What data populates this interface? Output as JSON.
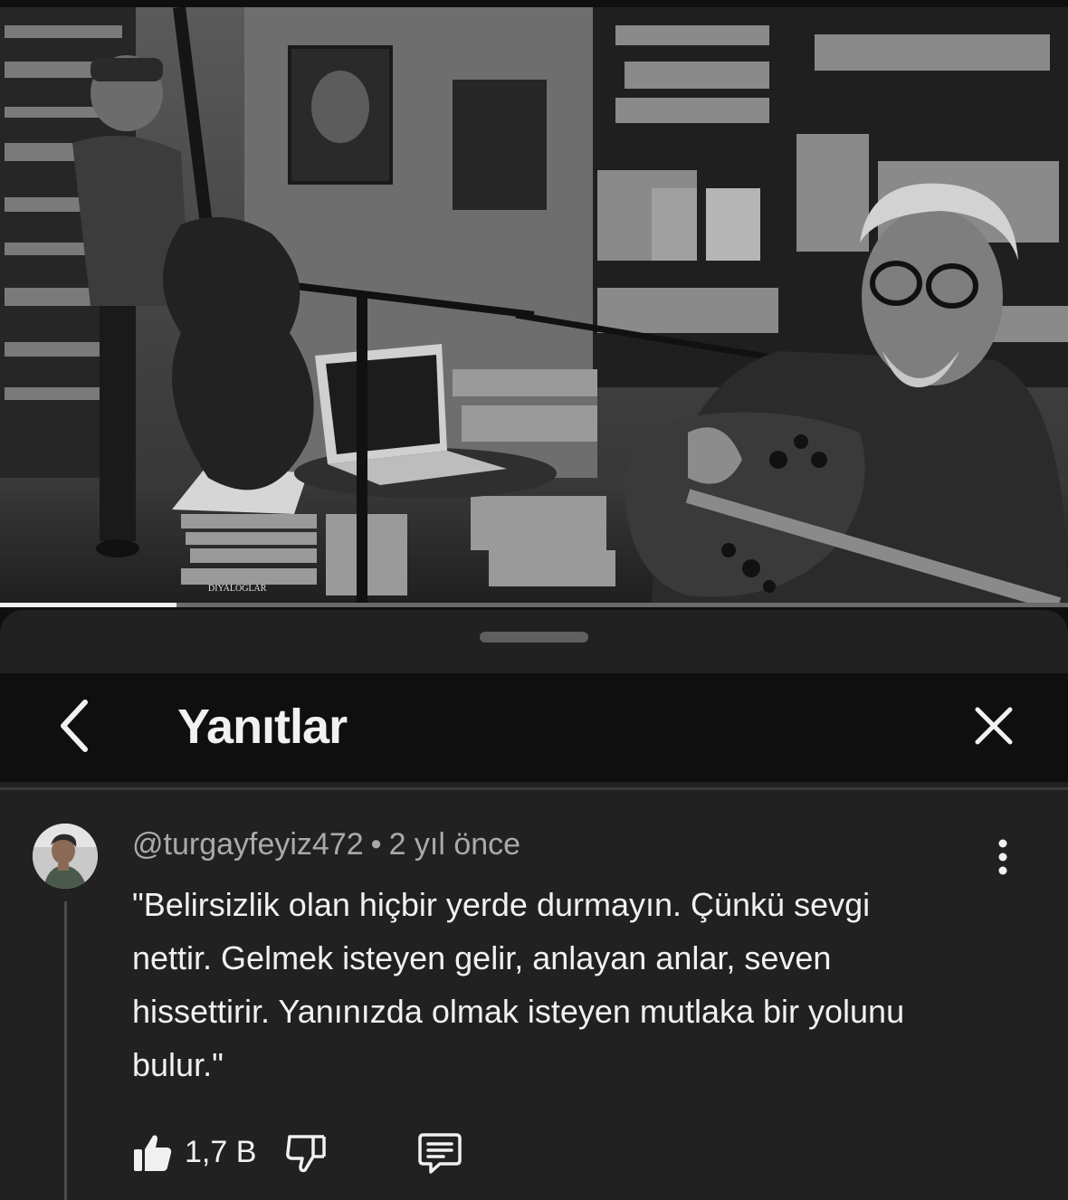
{
  "video": {
    "book_spine_text": "DIYALOGLAR",
    "progress_fraction": 0.165
  },
  "sheet": {
    "title": "Yanıtlar"
  },
  "comment": {
    "author": "@turgayfeyiz472",
    "separator": "•",
    "time": "2 yıl önce",
    "text": "\"Belirsizlik olan hiçbir yerde durmayın. Çünkü sevgi nettir. Gelmek isteyen gelir, anlayan anlar, seven hissettirir. Yanınızda olmak isteyen mutlaka bir yolunu bulur.\"",
    "like_count": "1,7 B"
  },
  "icons": {
    "back": "chevron-left-icon",
    "close": "close-icon",
    "more": "more-vertical-icon",
    "like": "thumbs-up-icon",
    "dislike": "thumbs-down-icon",
    "reply": "comment-icon"
  }
}
